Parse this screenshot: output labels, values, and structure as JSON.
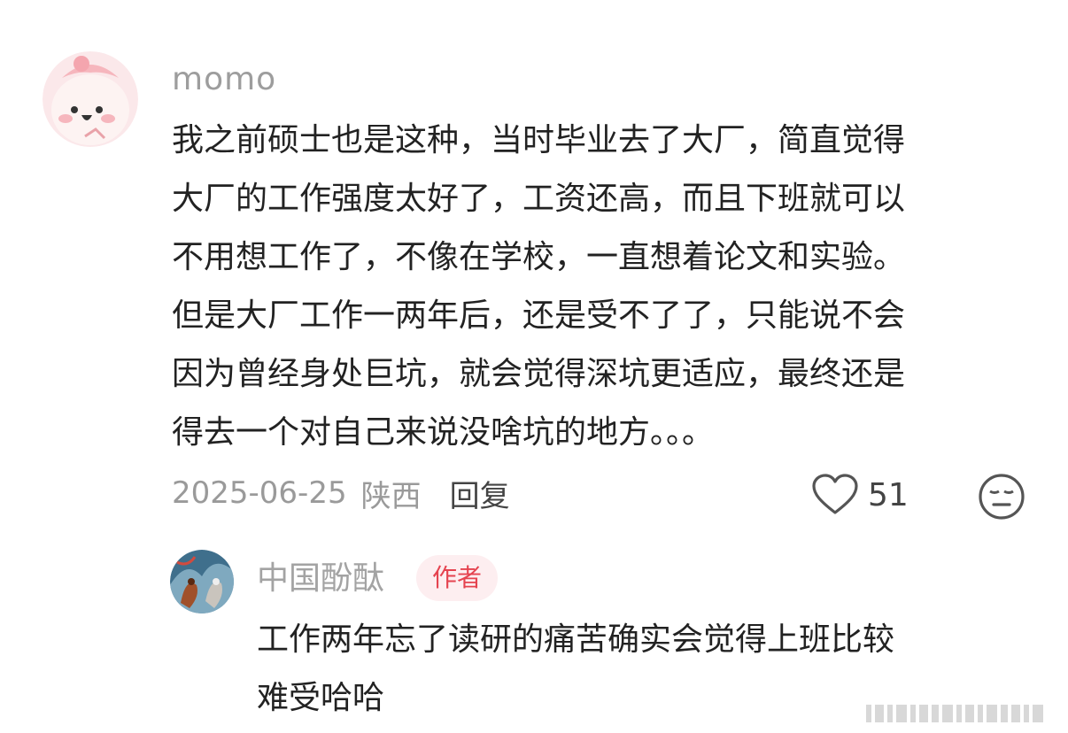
{
  "comment": {
    "username": "momo",
    "lines": [
      "我之前硕士也是这种，当时毕业去了大厂，简直觉得",
      "大厂的工作强度太好了，工资还高，而且下班就可以",
      "不用想工作了，不像在学校，一直想着论文和实验。",
      "但是大厂工作一两年后，还是受不了了，只能说不会",
      "因为曾经身处巨坑，就会觉得深坑更适应，最终还是",
      "得去一个对自己来说没啥坑的地方。。。"
    ],
    "date": "2025-06-25",
    "location": "陕西",
    "reply_label": "回复",
    "like_count": "51",
    "like_icon": "heart-outline-icon",
    "emoji_icon": "sleepy-face-icon"
  },
  "reply": {
    "username": "中国酚酞",
    "badge": "作者",
    "badge_color": "#e5434f",
    "lines": [
      "工作两年忘了读研的痛苦确实会觉得上班比较",
      "难受哈哈"
    ]
  }
}
